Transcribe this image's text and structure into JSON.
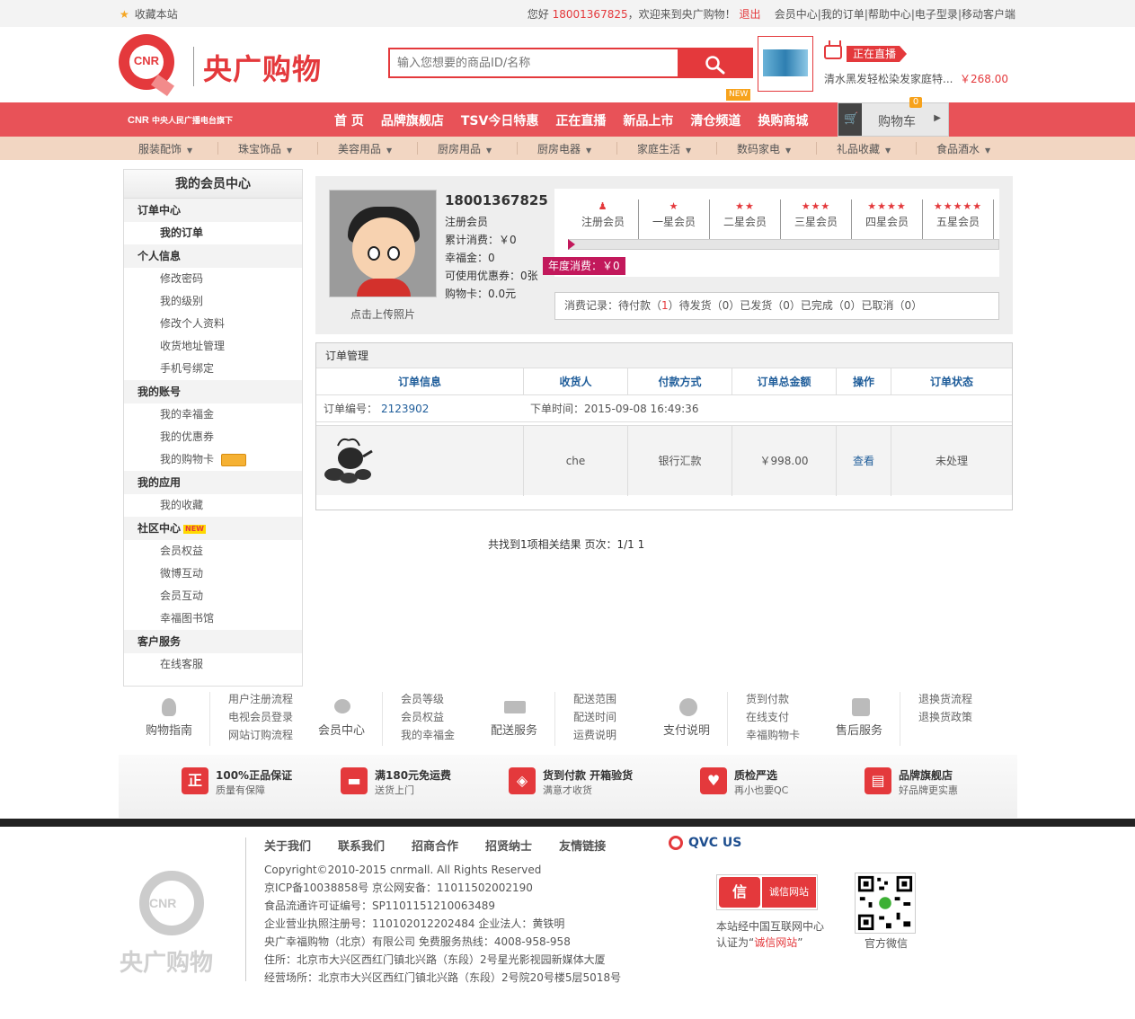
{
  "topbar": {
    "favorite": "收藏本站",
    "greeting": "您好",
    "phone": "18001367825",
    "welcome": "，欢迎来到央广购物！",
    "logout": "退出",
    "links": [
      "会员中心",
      "|",
      "我的订单",
      "|",
      "帮助中心",
      "|",
      "电子型录",
      "|",
      "移动客户端"
    ]
  },
  "header": {
    "logo_cnr": "CNR",
    "logo_name": "央广购物",
    "search_placeholder": "输入您想要的商品ID/名称",
    "live_tag": "正在直播",
    "live_product": "清水黑发轻松染发家庭特...",
    "live_price": "￥268.00"
  },
  "mainnav": {
    "brand": "中央人民广播电台旗下",
    "items": [
      "首 页",
      "品牌旗舰店",
      "TSV今日特惠",
      "正在直播",
      "新品上市",
      "清仓频道",
      "换购商城"
    ],
    "new_badge": "NEW",
    "cart_label": "购物车",
    "cart_count": "0"
  },
  "categories": [
    "服装配饰",
    "珠宝饰品",
    "美容用品",
    "厨房用品",
    "厨房电器",
    "家庭生活",
    "数码家电",
    "礼品收藏",
    "食品酒水"
  ],
  "sidebar": {
    "title": "我的会员中心",
    "groups": [
      {
        "title": "订单中心",
        "items": [
          "我的订单"
        ]
      },
      {
        "title": "个人信息",
        "items": [
          "修改密码",
          "我的级别",
          "修改个人资料",
          "收货地址管理",
          "手机号绑定"
        ]
      },
      {
        "title": "我的账号",
        "items": [
          "我的幸福金",
          "我的优惠券",
          "我的购物卡"
        ]
      },
      {
        "title": "我的应用",
        "items": [
          "我的收藏"
        ]
      },
      {
        "title": "社区中心",
        "items": [
          "会员权益",
          "微博互动",
          "会员互动",
          "幸福图书馆"
        ]
      },
      {
        "title": "客户服务",
        "items": [
          "在线客服"
        ]
      }
    ],
    "new_tag": "NEW"
  },
  "profile": {
    "name": "18001367825",
    "level": "注册会员",
    "total_spent": "累计消费：￥0",
    "happiness": "幸福金：0",
    "coupons": "可使用优惠券：0张",
    "gift_card": "购物卡：0.0元",
    "upload_photo": "点击上传照片",
    "levels": [
      {
        "name": "注册会员",
        "stars": "♟"
      },
      {
        "name": "一星会员",
        "stars": "★"
      },
      {
        "name": "二星会员",
        "stars": "★★"
      },
      {
        "name": "三星会员",
        "stars": "★★★"
      },
      {
        "name": "四星会员",
        "stars": "★★★★"
      },
      {
        "name": "五星会员",
        "stars": "★★★★★"
      }
    ],
    "year_spent": "年度消费：￥0",
    "records_label": "消费记录：待付款（",
    "records_pending": "1",
    "records_rest": "）待发货（0）已发货（0）已完成（0）已取消（0）"
  },
  "orders": {
    "title": "订单管理",
    "columns": [
      "订单信息",
      "收货人",
      "付款方式",
      "订单总金额",
      "操作",
      "订单状态"
    ],
    "order_no_label": "订单编号：",
    "order_no": "2123902",
    "order_time": "下单时间：2015-09-08 16:49:36",
    "row": {
      "receiver": "che",
      "payment": "银行汇款",
      "amount": "￥998.00",
      "action": "查看",
      "status": "未处理"
    },
    "pager": "共找到1项相关结果  页次：1/1    1"
  },
  "help": [
    {
      "title": "购物指南",
      "links": [
        "用户注册流程",
        "电视会员登录",
        "网站订购流程"
      ]
    },
    {
      "title": "会员中心",
      "links": [
        "会员等级",
        "会员权益",
        "我的幸福金"
      ]
    },
    {
      "title": "配送服务",
      "links": [
        "配送范围",
        "配送时间",
        "运费说明"
      ]
    },
    {
      "title": "支付说明",
      "links": [
        "货到付款",
        "在线支付",
        "幸福购物卡"
      ]
    },
    {
      "title": "售后服务",
      "links": [
        "退换货流程",
        "退换货政策"
      ]
    }
  ],
  "guarantees": [
    {
      "icon": "正",
      "title": "100%正品保证",
      "sub": "质量有保障"
    },
    {
      "icon": "▬",
      "title": "满180元免运费",
      "sub": "送货上门"
    },
    {
      "icon": "◈",
      "title": "货到付款  开箱验货",
      "sub": "满意才收货"
    },
    {
      "icon": "♥",
      "title": "质检严选",
      "sub": "再小也要QC"
    },
    {
      "icon": "▤",
      "title": "品牌旗舰店",
      "sub": "好品牌更实惠"
    }
  ],
  "footer": {
    "logo_cnr": "CNR",
    "logo_name": "央广购物",
    "links": [
      "关于我们",
      "联系我们",
      "招商合作",
      "招贤纳士",
      "友情链接"
    ],
    "qvc": "QVC US",
    "info": [
      "Copyright©2010-2015 cnrmall. All Rights Reserved",
      "京ICP备10038858号 京公网安备：11011502002190",
      "食品流通许可证编号：SP1101151210063489",
      "企业营业执照注册号：110102012202484    企业法人：黄铁明",
      "央广幸福购物（北京）有限公司 免费服务热线：4008-958-958",
      "住所：北京市大兴区西红门镇北兴路（东段）2号星光影视园新媒体大厦",
      "经营场所：北京市大兴区西红门镇北兴路（东段）2号院20号楼5层5018号"
    ],
    "trust_icon": "信",
    "trust_label": "诚信网站",
    "trust_text1": "本站经中国互联网中心",
    "trust_text2a": "认证为“",
    "trust_text2b": "诚信网站",
    "trust_text2c": "”",
    "wechat": "官方微信"
  },
  "colors": {
    "brand_red": "#e4393c",
    "nav_red": "#e85258",
    "cat_bg": "#f2d6c2",
    "link_blue": "#1f5d9a"
  }
}
